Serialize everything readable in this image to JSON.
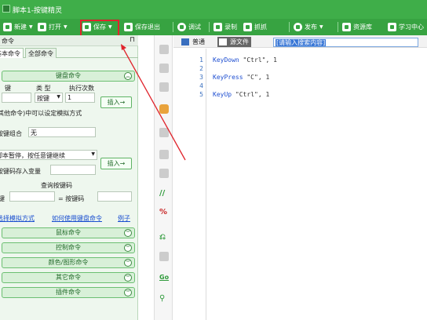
{
  "window": {
    "title": "脚本1-按键精灵"
  },
  "toolbar": {
    "new_label": "新建",
    "open_label": "打开",
    "save_label": "保存",
    "save_exit_label": "保存退出",
    "debug_label": "调试",
    "record_label": "录制",
    "capture_label": "抓抓",
    "publish_label": "发布",
    "resource_label": "资源库",
    "learn_label": "学习中心",
    "highlight_color": "#e0242c",
    "accent": "#37a341"
  },
  "left_panel": {
    "title": "命令",
    "tabs": [
      "基本命令",
      "全部命令"
    ],
    "keyboard_section": {
      "header": "键盘命令",
      "col_key": "键",
      "col_type": "类 型",
      "col_count": "执行次数",
      "type_value": "按键",
      "count_value": "1",
      "insert_label": "插入→",
      "hint": "(其他命令)中可以设定模拟方式",
      "combo_label": "按键组合",
      "combo_value": "无",
      "pause_option": "脚本暂停，按任意键继续",
      "insert_label_2": "插入→",
      "save_var_label": "按键码存入变量",
      "query_label": "查询按键码",
      "key_label": "键",
      "eq_label": "= 按键码",
      "link_choose": "选择模拟方式",
      "link_how": "如何使用键盘命令",
      "link_example": "例子"
    },
    "sections": [
      "鼠标命令",
      "控制命令",
      "颜色/图形命令",
      "其它命令",
      "插件命令"
    ]
  },
  "editor": {
    "tabs": [
      "普通",
      "源文件"
    ],
    "active_tab": "源文件",
    "search_text": "[请输入搜索内容]",
    "lines": [
      {
        "n": "1",
        "cmd": "KeyDown",
        "arg": "\"Ctrl\"",
        "count": "1"
      },
      {
        "n": "2",
        "cmd": "",
        "arg": "",
        "count": ""
      },
      {
        "n": "3",
        "cmd": "KeyPress",
        "arg": "\"C\"",
        "count": "1"
      },
      {
        "n": "4",
        "cmd": "",
        "arg": "",
        "count": ""
      },
      {
        "n": "5",
        "cmd": "KeyUp",
        "arg": "\"Ctrl\"",
        "count": "1"
      }
    ]
  },
  "vertical_toolbar": {
    "go_label": "Go"
  }
}
